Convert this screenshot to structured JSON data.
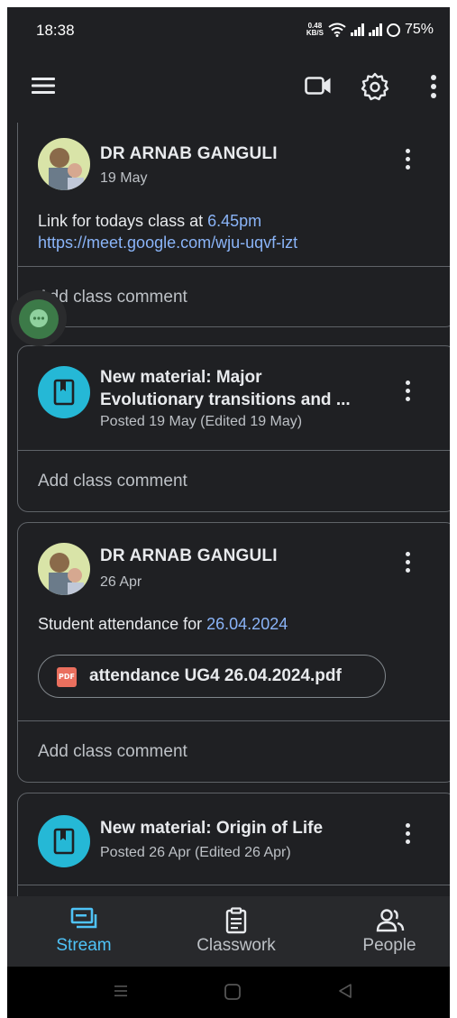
{
  "status_bar": {
    "time": "18:38",
    "net_speed_value": "0.48",
    "net_speed_unit": "KB/S",
    "battery": "75%"
  },
  "app_bar": {
    "icons": [
      "menu-icon",
      "video-camera-icon",
      "settings-icon",
      "more-vert-icon"
    ]
  },
  "posts": [
    {
      "author": "DR ARNAB GANGULI",
      "date": "19 May",
      "text_prefix": "Link for todays class at ",
      "text_link": "6.45pm",
      "url": "https://meet.google.com/wju-uqvf-izt",
      "comment_placeholder": "Add class comment"
    },
    {
      "title_line1": "New material: Major",
      "title_line2": "Evolutionary transitions and ...",
      "subtitle": "Posted 19 May (Edited 19 May)",
      "comment_placeholder": "Add class comment"
    },
    {
      "author": "DR ARNAB GANGULI",
      "date": "26 Apr",
      "text_prefix": "Student attendance for ",
      "text_link": "26.04.2024",
      "attachment_badge": "PDF",
      "attachment": "attendance UG4 26.04.2024.pdf",
      "comment_placeholder": "Add class comment"
    },
    {
      "title_line1": "New material: Origin of Life",
      "subtitle": "Posted 26 Apr (Edited 26 Apr)"
    }
  ],
  "bottom_nav": {
    "items": [
      {
        "label": "Stream",
        "icon": "stream-icon",
        "active": true
      },
      {
        "label": "Classwork",
        "icon": "classwork-icon",
        "active": false
      },
      {
        "label": "People",
        "icon": "people-icon",
        "active": false
      }
    ]
  },
  "colors": {
    "background": "#1f2023",
    "accent": "#4fc3f7",
    "link": "#8ab4f8",
    "material_icon": "#25b8d6",
    "pdf": "#ea6f5e"
  }
}
